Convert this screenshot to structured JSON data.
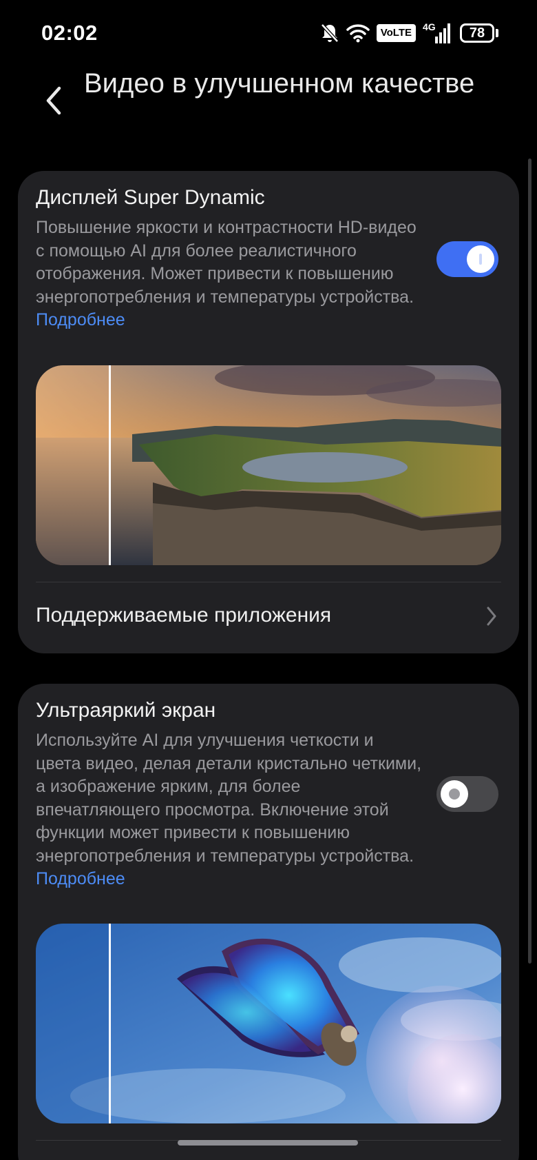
{
  "status_bar": {
    "time": "02:02",
    "volte_label": "VoLTE",
    "network_label": "4G",
    "battery_level": "78"
  },
  "header": {
    "title": "Видео в улучшенном качестве"
  },
  "super_dynamic": {
    "title": "Дисплей Super Dynamic",
    "description": "Повышение яркости и контрастности HD-видео с помощью AI для более реалистичного отображения. Может привести к повышению энергопотребления и температуры устройства. ",
    "link": "Подробнее",
    "enabled": true,
    "supported_apps_label": "Поддерживаемые приложения"
  },
  "ultra_bright": {
    "title": "Ультраяркий экран",
    "description": "Используйте AI для улучшения четкости и цвета видео, делая детали кристально четкими, а изображение ярким, для более впечатляющего просмотра. Включение этой функции может привести к повышению энергопотребления и температуры устройства. ",
    "link": "Подробнее",
    "enabled": false
  },
  "colors": {
    "accent": "#3f6ff3",
    "link": "#4d8cf5",
    "card_bg": "#212124"
  }
}
